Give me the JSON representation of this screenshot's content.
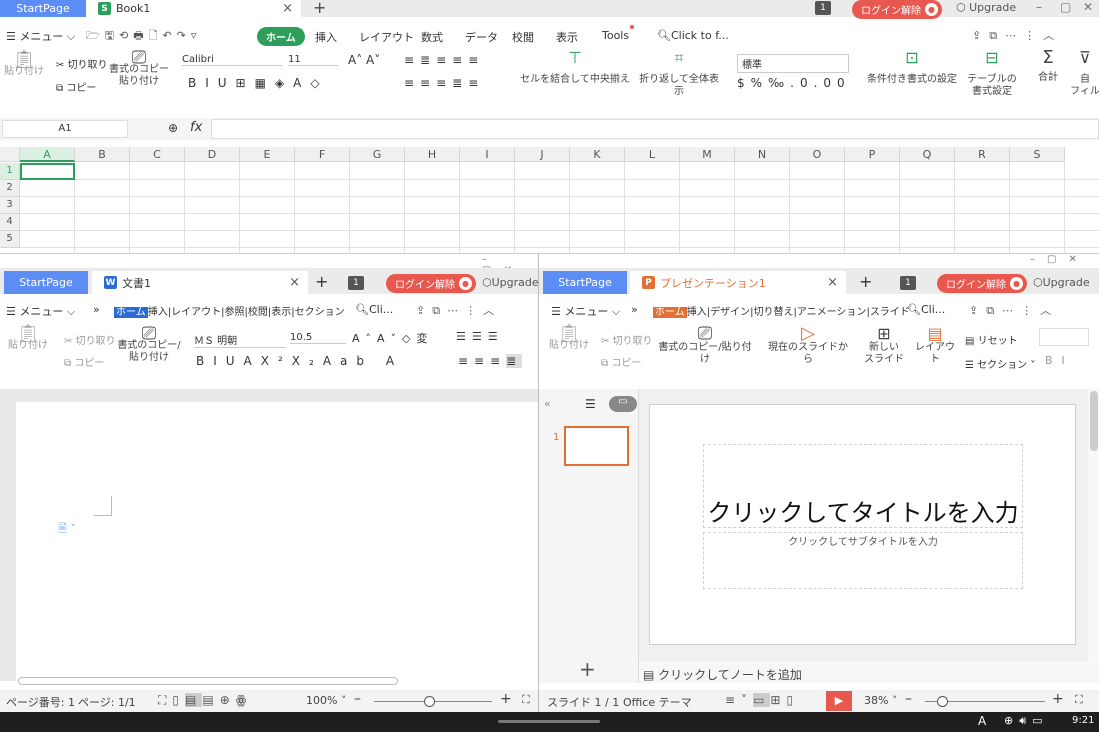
{
  "excel": {
    "start_tab": "StartPage",
    "doc_tab": "Book1",
    "doc_icon": "S",
    "badge": "1",
    "login": "ログイン解除",
    "upgrade": "Upgrade",
    "menu_label": "メニュー",
    "menu": [
      "ホーム",
      "挿入",
      "レイアウト",
      "数式",
      "データ",
      "校閲",
      "表示",
      "Tools"
    ],
    "search": "Click to f...",
    "paste": "貼り付け",
    "cut": "切り取り",
    "copy": "コピー",
    "format_copy": "書式のコピー/\n貼り付け",
    "format_copy_1": "書式のコピー",
    "format_copy_2": "貼り付け",
    "font": "Calibri",
    "size": "11",
    "merge": "セルを結合して中央揃え",
    "wrap": "折り返して全体表示",
    "numfmt": "標準",
    "cond": "条件付き書式の設定",
    "table1": "テーブルの",
    "table2": "書式設定",
    "sum": "合計",
    "filter1": "自",
    "filter2": "フィル",
    "namebox": "A1",
    "fx": "fx",
    "columns": [
      "A",
      "B",
      "C",
      "D",
      "E",
      "F",
      "G",
      "H",
      "I",
      "J",
      "K",
      "L",
      "M",
      "N",
      "O",
      "P",
      "Q",
      "R",
      "S"
    ],
    "rows": [
      "1",
      "2",
      "3",
      "4",
      "5"
    ]
  },
  "writer": {
    "start_tab": "StartPage",
    "doc_tab": "文書1",
    "doc_icon": "W",
    "badge": "1",
    "login": "ログイン解除",
    "upgrade": "Upgrade",
    "menu_label": "メニュー",
    "menu": [
      "ホーム",
      "挿入",
      "レイアウト",
      "参照",
      "校閲",
      "表示",
      "セクション"
    ],
    "search": "Cli...",
    "cut": "切り取り",
    "copy": "コピー",
    "paste": "貼り付け",
    "format_copy_1": "書式のコピー/",
    "format_copy_2": "貼り付け",
    "font": "ＭＳ 明朝",
    "size": "10.5",
    "status_page_no": "ページ番号: 1",
    "status_pages": "ページ: 1/1",
    "zoom": "100%"
  },
  "impress": {
    "start_tab": "StartPage",
    "doc_tab": "プレゼンテーション1",
    "doc_icon": "P",
    "badge": "1",
    "login": "ログイン解除",
    "upgrade": "Upgrade",
    "menu_label": "メニュー",
    "menu": [
      "ホーム",
      "挿入",
      "デザイン",
      "切り替え",
      "アニメーション",
      "スライド"
    ],
    "search": "Cli...",
    "paste": "貼り付け",
    "cut": "切り取り",
    "copy": "コピー",
    "format_copy": "書式のコピー/貼り付け",
    "from_current": "現在のスライドから",
    "new_slide_1": "新しい",
    "new_slide_2": "スライド",
    "layout": "レイアウト",
    "reset": "リセット",
    "section": "セクション",
    "thumb_number": "1",
    "title_placeholder": "クリックしてタイトルを入力",
    "subtitle_placeholder": "クリックしてサブタイトルを入力",
    "notes": "クリックしてノートを追加",
    "status_slide": "スライド 1 / 1",
    "theme": "Office テーマ",
    "zoom": "38%"
  },
  "taskbar": {
    "ime": "A",
    "time": "9:21"
  },
  "colors": {
    "start_tab": "#5b8df5",
    "excel_green": "#2e9f5b",
    "writer_blue": "#2b6bd6",
    "impress_orange": "#e07033",
    "login": "#e9584f"
  }
}
